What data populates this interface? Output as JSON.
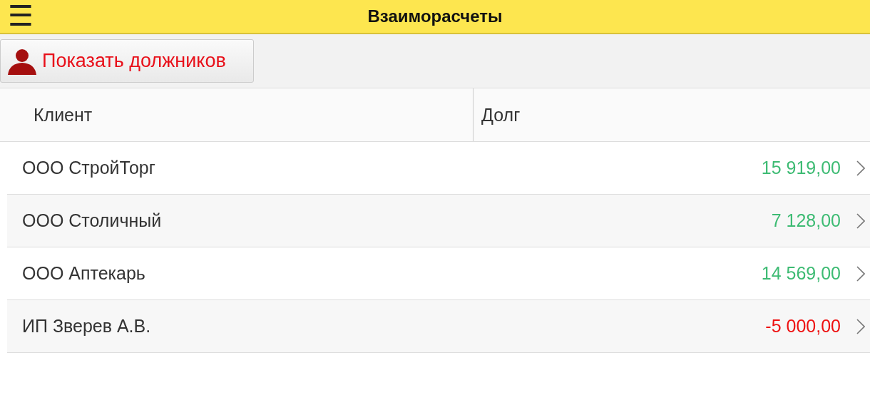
{
  "header": {
    "menu_icon": "☰",
    "title": "Взаиморасчеты"
  },
  "toolbar": {
    "button": "Показать должников"
  },
  "table": {
    "columns": [
      "Клиент",
      "Долг"
    ],
    "rows": [
      {
        "client": "ООО СтройТорг",
        "debt": "15 919,00",
        "color": "#3dbb73"
      },
      {
        "client": "ООО Столичный",
        "debt": "7 128,00",
        "color": "#3dbb73"
      },
      {
        "client": "ООО Аптекарь",
        "debt": "14 569,00",
        "color": "#3dbb73"
      },
      {
        "client": "ИП Зверев А.В.",
        "debt": "-5 000,00",
        "color": "#ee1111"
      }
    ]
  }
}
